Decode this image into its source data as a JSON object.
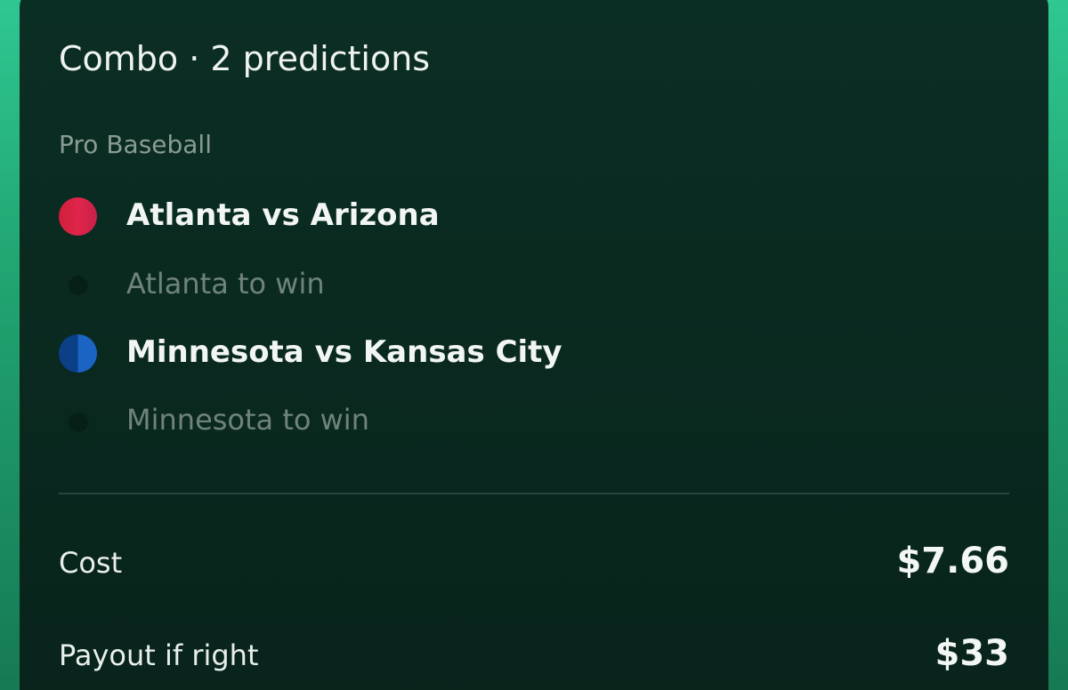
{
  "card": {
    "title": "Combo · 2 predictions",
    "category": "Pro Baseball"
  },
  "games": [
    {
      "matchup": "Atlanta vs Arizona",
      "pick": "Atlanta to win",
      "team_colors": [
        "#d11f3c",
        "#e0254a"
      ]
    },
    {
      "matchup": "Minnesota vs Kansas City",
      "pick": "Minnesota to win",
      "team_colors": [
        "#0b3f86",
        "#1b64c4"
      ]
    }
  ],
  "summary": {
    "cost_label": "Cost",
    "cost_value": "$7.66",
    "payout_label": "Payout if right",
    "payout_value": "$33"
  },
  "colors": {
    "background_accent": "#22a874",
    "card_background": "#0a2a20"
  }
}
